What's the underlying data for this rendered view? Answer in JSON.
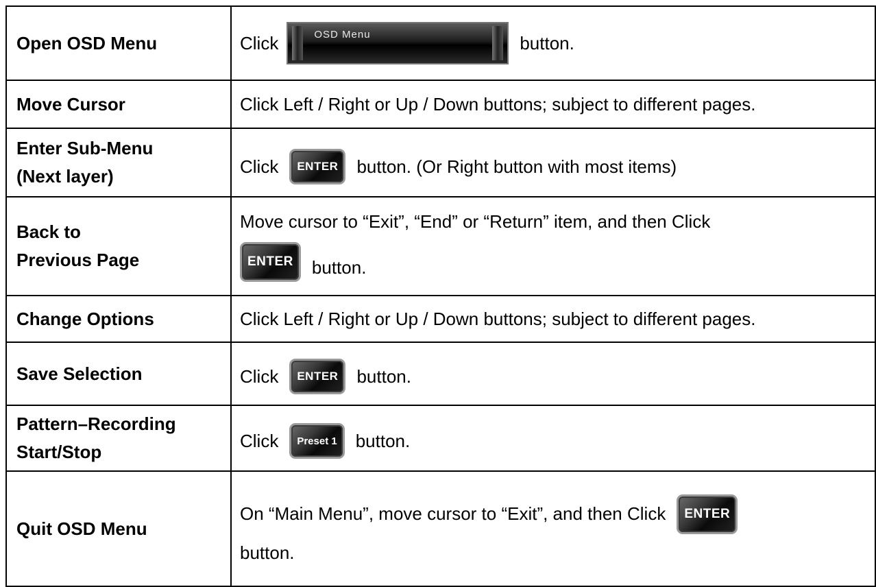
{
  "rows": [
    {
      "label": "Open OSD Menu",
      "before": "Click",
      "button": "OSD Menu",
      "after": "button."
    },
    {
      "label": "Move Cursor",
      "text": "Click Left / Right or Up / Down buttons; subject to different pages."
    },
    {
      "label_line1": "Enter Sub-Menu",
      "label_line2": "(Next layer)",
      "before": "Click",
      "button": "ENTER",
      "after": "button. (Or Right button with most items)"
    },
    {
      "label_line1": "Back to",
      "label_line2": "Previous Page",
      "line1": "Move cursor to “Exit”, “End” or “Return” item, and then Click",
      "button": "ENTER",
      "after": "button."
    },
    {
      "label": "Change Options",
      "text": "Click Left / Right or Up / Down buttons; subject to different pages."
    },
    {
      "label": "Save Selection",
      "before": "Click",
      "button": "ENTER",
      "after": "button."
    },
    {
      "label_line1": "Pattern–Recording",
      "label_line2": "Start/Stop",
      "before": "Click",
      "button": "Preset 1",
      "after": "button."
    },
    {
      "label": "Quit OSD Menu",
      "line1": "On “Main Menu”, move cursor to “Exit”, and then Click",
      "button": "ENTER",
      "line2": "button."
    }
  ]
}
